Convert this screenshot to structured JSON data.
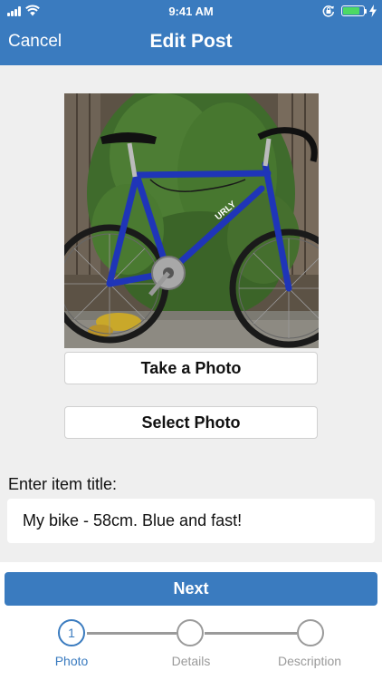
{
  "status_bar": {
    "time": "9:41 AM",
    "battery_level": 0.85,
    "icons": [
      "signal-icon",
      "wifi-icon",
      "rotation-lock-icon",
      "battery-icon",
      "charging-icon"
    ]
  },
  "nav": {
    "cancel_label": "Cancel",
    "title": "Edit Post"
  },
  "photo": {
    "description_icon": "bicycle-photo"
  },
  "buttons": {
    "take_photo": "Take a Photo",
    "select_photo": "Select Photo"
  },
  "title_field": {
    "label": "Enter item title:",
    "value": "My bike - 58cm. Blue and fast!"
  },
  "next_label": "Next",
  "stepper": {
    "steps": [
      {
        "number": "1",
        "label": "Photo",
        "active": true
      },
      {
        "number": "",
        "label": "Details",
        "active": false
      },
      {
        "number": "",
        "label": "Description",
        "active": false
      }
    ]
  },
  "colors": {
    "accent": "#3a7bbf",
    "inactive": "#9a9a9a",
    "background": "#efefef"
  }
}
